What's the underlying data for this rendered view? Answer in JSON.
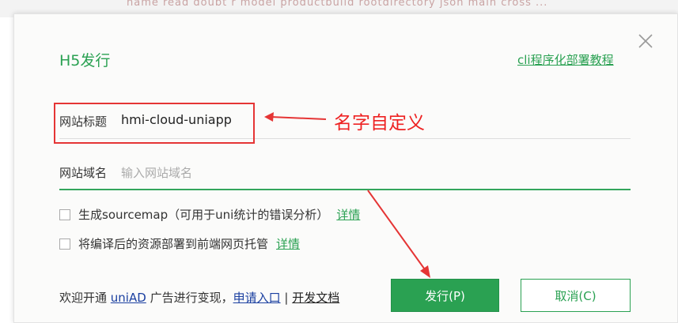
{
  "background": {
    "text": "name  read  doubt  r  model  productbuild  rootdirectory  json  main  cross  ..."
  },
  "dialog": {
    "title": "H5发行",
    "doc_link": "cli程序化部署教程",
    "close_icon": "close-icon"
  },
  "fields": {
    "site_title": {
      "label": "网站标题",
      "value": "hmi-cloud-uniapp"
    },
    "site_domain": {
      "label": "网站域名",
      "placeholder": "输入网站域名"
    }
  },
  "annotation": {
    "text": "名字自定义",
    "color": "#e53535"
  },
  "options": [
    {
      "label": "生成sourcemap（可用于uni统计的错误分析）",
      "link": "详情",
      "checked": false
    },
    {
      "label": "将编译后的资源部署到前端网页托管",
      "link": "详情",
      "checked": false
    }
  ],
  "footer": {
    "prefix": "欢迎开通",
    "uniad": "uniAD",
    "middle": "广告进行变现，",
    "apply": "申请入口",
    "divider": "|",
    "docs": "开发文档"
  },
  "buttons": {
    "publish": "发行(P)",
    "cancel": "取消(C)"
  },
  "colors": {
    "accent": "#2aa152",
    "annotation": "#e53535"
  }
}
